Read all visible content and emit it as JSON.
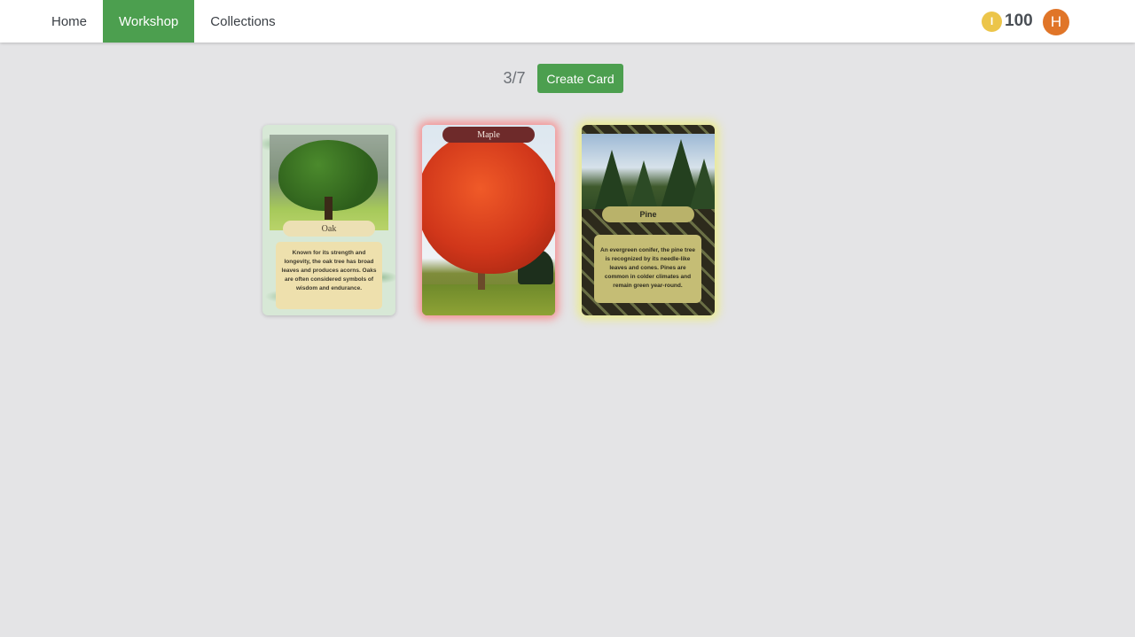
{
  "nav": {
    "items": [
      {
        "label": "Home",
        "active": false
      },
      {
        "label": "Workshop",
        "active": true
      },
      {
        "label": "Collections",
        "active": false
      }
    ]
  },
  "user": {
    "coin_icon_glyph": "I",
    "coin_icon": "coin-icon",
    "coins": "100",
    "avatar_initial": "H"
  },
  "workshop": {
    "counter": "3/7",
    "create_button_label": "Create Card"
  },
  "cards": [
    {
      "name": "Oak",
      "description": "Known for its strength and longevity, the oak tree has broad leaves and produces acorns. Oaks are often considered symbols of wisdom and endurance.",
      "glow": "none"
    },
    {
      "name": "Maple",
      "glow": "#ff5a5a"
    },
    {
      "name": "Pine",
      "description": "An evergreen conifer, the pine tree is recognized by its needle-like leaves and cones. Pines are common in colder climates and remain green year-round.",
      "glow": "#ecec78"
    }
  ],
  "colors": {
    "accent": "#4c9f4f",
    "coin": "#ecc54a",
    "avatar": "#e07528",
    "background": "#e4e4e6"
  }
}
